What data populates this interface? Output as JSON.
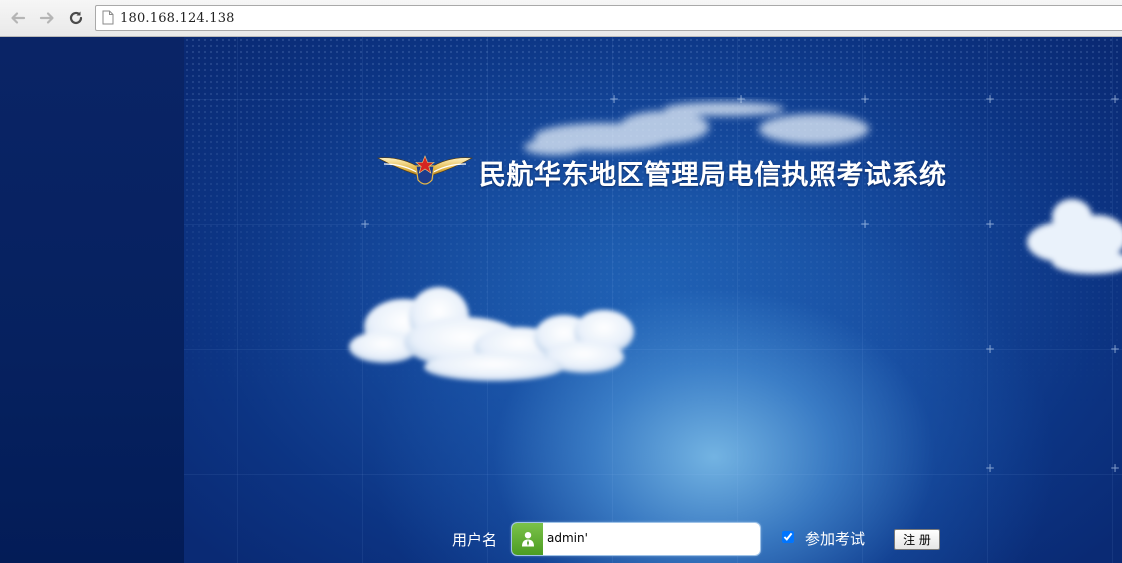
{
  "browser": {
    "url": "180.168.124.138",
    "back_icon": "arrow-left-icon",
    "forward_icon": "arrow-right-icon",
    "reload_icon": "reload-icon",
    "page_icon": "page-icon"
  },
  "header": {
    "title": "民航华东地区管理局电信执照考试系统",
    "logo_icon": "winged-star-emblem-icon"
  },
  "login": {
    "username_label": "用户名",
    "username_value": "admin'",
    "user_icon": "user-icon",
    "exam_checkbox_label": "参加考试",
    "exam_checkbox_checked": true,
    "register_button": "注 册"
  },
  "colors": {
    "page_background": "#0a2c73",
    "accent_green": "#5aab2c",
    "text_white": "#ffffff"
  }
}
